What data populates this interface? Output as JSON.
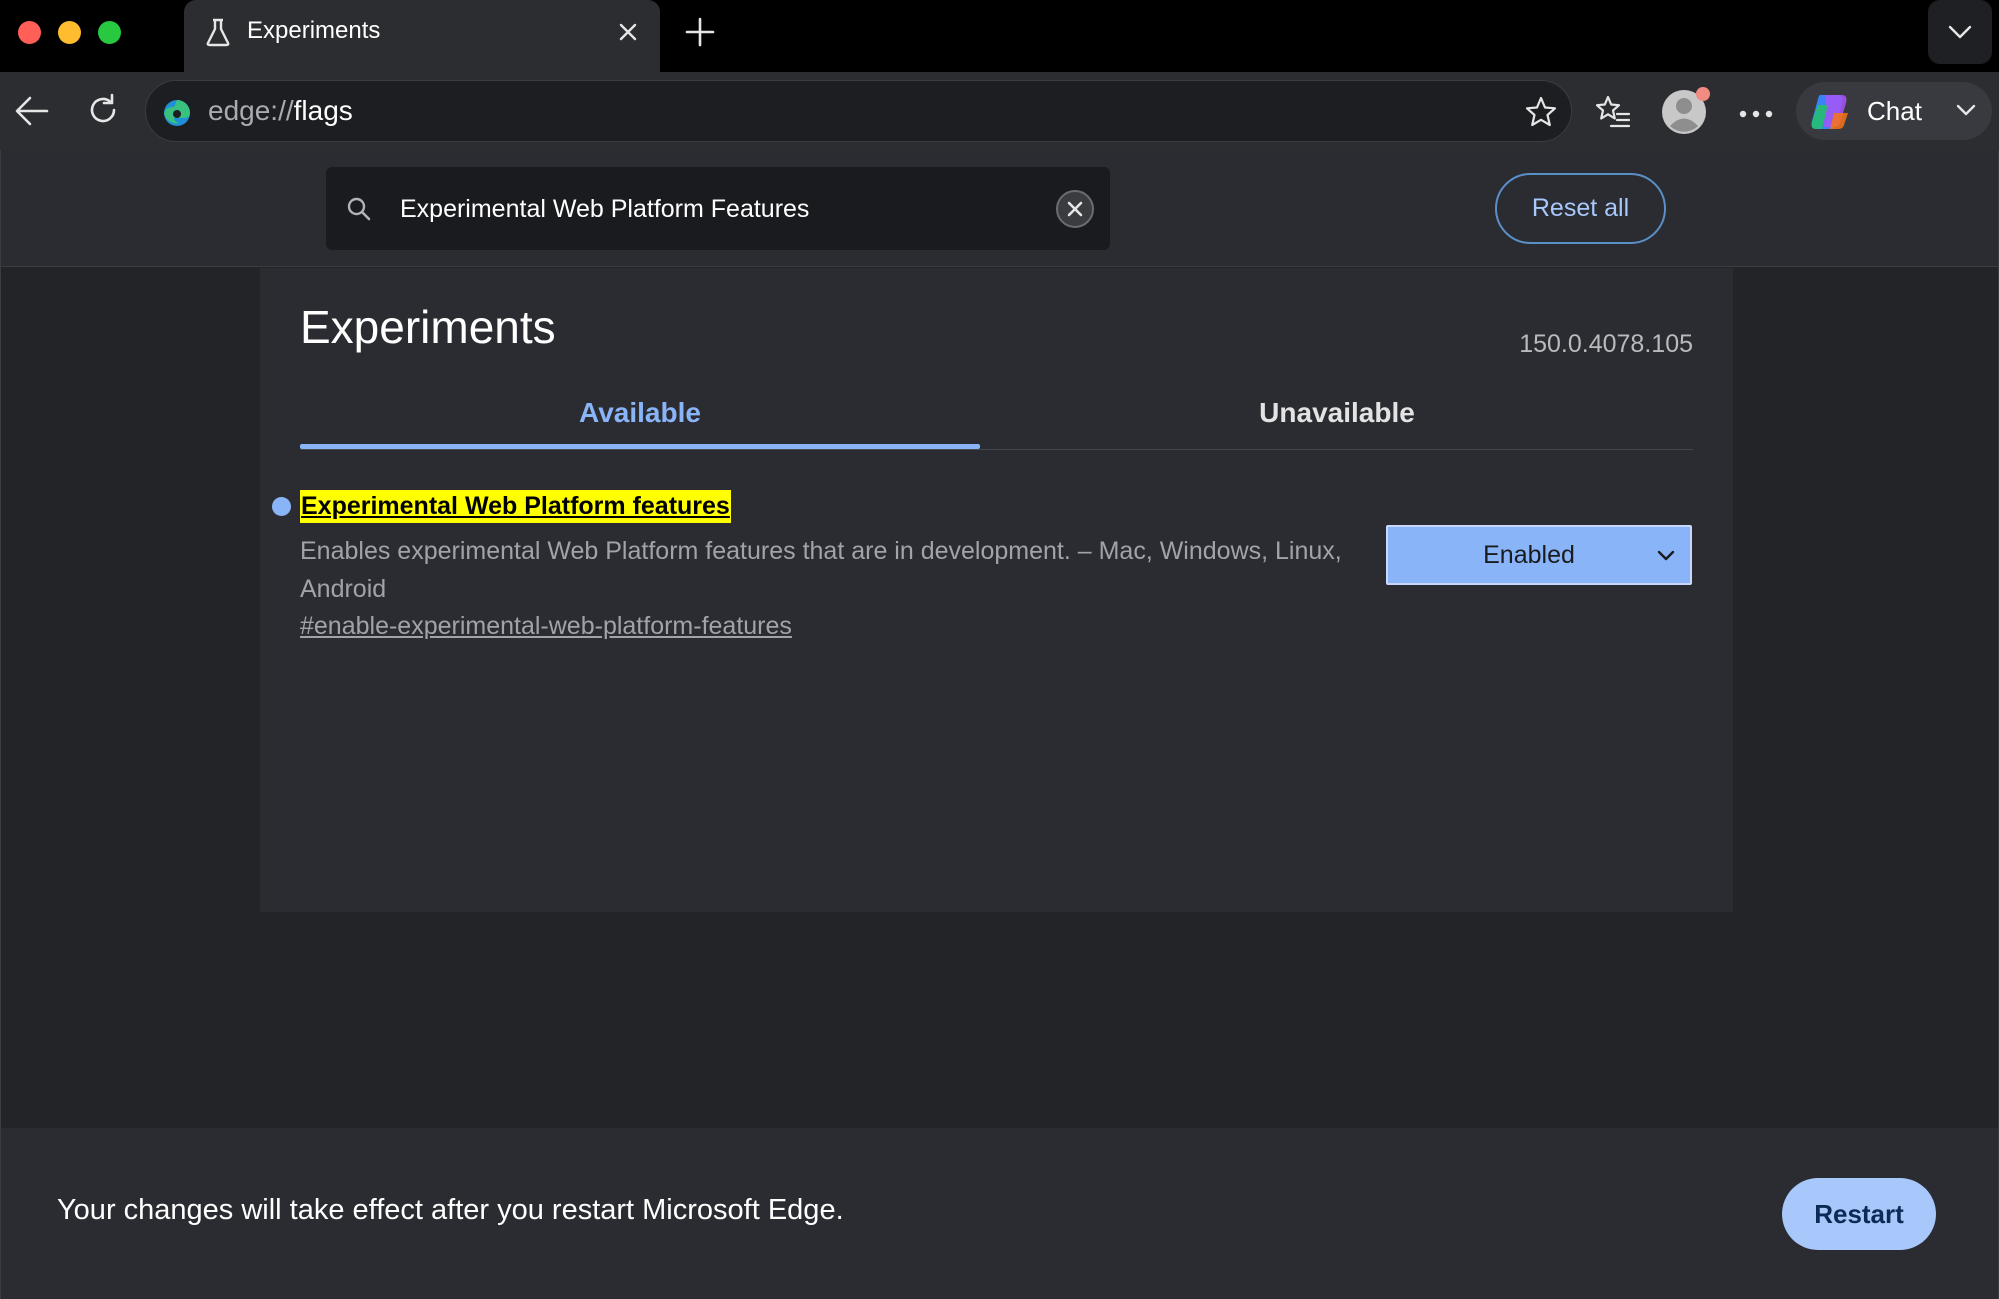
{
  "tab": {
    "title": "Experiments",
    "icon": "flask-icon"
  },
  "address_bar": {
    "scheme": "edge://",
    "host": "flags"
  },
  "toolbar": {
    "chat_label": "Chat"
  },
  "search": {
    "value": "Experimental Web Platform Features"
  },
  "header": {
    "reset_label": "Reset all"
  },
  "page": {
    "title": "Experiments",
    "version": "150.0.4078.105",
    "tabs": [
      {
        "label": "Available",
        "selected": true
      },
      {
        "label": "Unavailable",
        "selected": false
      }
    ]
  },
  "flag": {
    "name": "Experimental Web Platform features",
    "description": "Enables experimental Web Platform features that are in development. – Mac, Windows, Linux, Android",
    "link": "#enable-experimental-web-platform-features",
    "selected_value": "Enabled"
  },
  "restart_bar": {
    "message": "Your changes will take effect after you restart Microsoft Edge.",
    "button_label": "Restart"
  },
  "colors": {
    "accent": "#8ab4f8",
    "highlight": "#ffff00",
    "page_bg": "#222428",
    "panel_bg": "#2a2c31"
  }
}
